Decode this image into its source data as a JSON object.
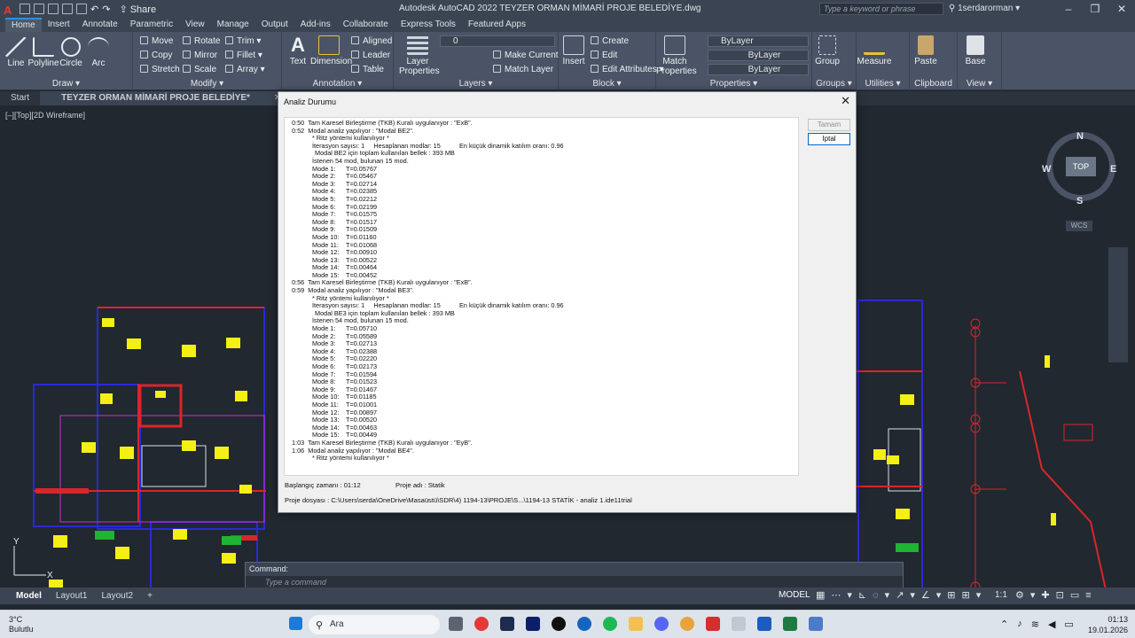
{
  "app": {
    "window_title": "Autodesk AutoCAD 2022   TEYZER ORMAN MİMARİ PROJE BELEDİYE.dwg",
    "share_label": "Share",
    "search_placeholder": "Type a keyword or phrase",
    "user_name": "1serdarorman"
  },
  "ribbon_tabs": [
    "Home",
    "Insert",
    "Annotate",
    "Parametric",
    "View",
    "Manage",
    "Output",
    "Add-ins",
    "Collaborate",
    "Express Tools",
    "Featured Apps"
  ],
  "ribbon": {
    "draw": {
      "label": "Draw",
      "line": "Line",
      "polyline": "Polyline",
      "circle": "Circle",
      "arc": "Arc"
    },
    "modify": {
      "label": "Modify",
      "move": "Move",
      "rotate": "Rotate",
      "trim": "Trim",
      "copy": "Copy",
      "mirror": "Mirror",
      "fillet": "Fillet",
      "stretch": "Stretch",
      "scale": "Scale",
      "array": "Array"
    },
    "annotation": {
      "label": "Annotation",
      "text": "Text",
      "dimension": "Dimension",
      "aligned": "Aligned",
      "leader": "Leader",
      "table": "Table"
    },
    "layers": {
      "label": "Layers",
      "layer_properties": "Layer Properties",
      "make_current": "Make Current",
      "match_layer": "Match Layer",
      "current_layer": "0"
    },
    "block": {
      "label": "Block",
      "insert": "Insert",
      "create": "Create",
      "edit": "Edit",
      "edit_attributes": "Edit Attributes"
    },
    "properties": {
      "label": "Properties",
      "match_properties": "Match Properties",
      "bylayer1": "ByLayer",
      "bylayer2": "ByLayer",
      "bylayer3": "ByLayer"
    },
    "groups": {
      "label": "Groups",
      "group": "Group"
    },
    "utilities": {
      "label": "Utilities",
      "measure": "Measure"
    },
    "clipboard": {
      "label": "Clipboard",
      "paste": "Paste"
    },
    "view": {
      "label": "View",
      "base": "Base"
    }
  },
  "doc_tabs": {
    "start": "Start",
    "active": "TEYZER ORMAN MİMARİ PROJE BELEDİYE*"
  },
  "viewport": {
    "label": "[–][Top][2D Wireframe]",
    "viewcube_top": "TOP",
    "compass_n": "N",
    "compass_s": "S",
    "compass_e": "E",
    "compass_w": "W",
    "wcs": "WCS"
  },
  "command": {
    "prompt": "Command:",
    "placeholder": "Type a command"
  },
  "layout_tabs": {
    "model": "Model",
    "layout1": "Layout1",
    "layout2": "Layout2"
  },
  "statusbar": {
    "model_label": "MODEL",
    "scale": "1:1"
  },
  "taskbar": {
    "temperature": "3°C",
    "weather": "Bulutlu",
    "search": "Ara",
    "time": "01:13",
    "date": "19.01.2026"
  },
  "dialog": {
    "title": "Analiz Durumu",
    "ok_button": "Tamam",
    "cancel_button": "Iptal",
    "start_time_label": "Başlangıç zamanı  :  01:12",
    "project_name_label": "Proje adı  :  Statik",
    "project_file_label": "Proje dosyası  :  C:\\Users\\serda\\OneDrive\\Masaüstü\\SDR\\4) 1194-13\\PROJE\\S...\\1194-13 STATİK - analiz 1.ide11trial",
    "log": {
      "l01": "0:50  Tam Karesel Birleştirme (TKB) Kuralı uygulanıyor : \"ExB\".",
      "l02": "0:52  Modal analiz yapılıyor : \"Modal BE2\".",
      "l03": "* Ritz yöntemi kullanılıyor *",
      "l04a": "İterasyon sayısı: 1     Hesaplanan modlar: 15",
      "l04b": "En küçük dinamik katılım oranı: 0.96",
      "l05": "Modal BE2 için toplam kullanılan bellek : 393 MB",
      "l06": "İstenen 54 mod, bulunan 15 mod.",
      "modes_be2": [
        [
          "Mode 1:",
          "T=0.05767"
        ],
        [
          "Mode 2:",
          "T=0.05467"
        ],
        [
          "Mode 3:",
          "T=0.02714"
        ],
        [
          "Mode 4:",
          "T=0.02385"
        ],
        [
          "Mode 5:",
          "T=0.02212"
        ],
        [
          "Mode 6:",
          "T=0.02199"
        ],
        [
          "Mode 7:",
          "T=0.01575"
        ],
        [
          "Mode 8:",
          "T=0.01517"
        ],
        [
          "Mode 9:",
          "T=0.01509"
        ],
        [
          "Mode 10:",
          "T=0.01160"
        ],
        [
          "Mode 11:",
          "T=0.01068"
        ],
        [
          "Mode 12:",
          "T=0.00910"
        ],
        [
          "Mode 13:",
          "T=0.00522"
        ],
        [
          "Mode 14:",
          "T=0.00464"
        ],
        [
          "Mode 15:",
          "T=0.00452"
        ]
      ],
      "l07": "0:56  Tam Karesel Birleştirme (TKB) Kuralı uygulanıyor : \"ExB\".",
      "l08": "0:59  Modal analiz yapılıyor : \"Modal BE3\".",
      "l09": "* Ritz yöntemi kullanılıyor *",
      "l10a": "İterasyon sayısı: 1     Hesaplanan modlar: 15",
      "l10b": "En küçük dinamik katılım oranı: 0.96",
      "l11": "Modal BE3 için toplam kullanılan bellek : 393 MB",
      "l12": "İstenen 54 mod, bulunan 15 mod.",
      "modes_be3": [
        [
          "Mode 1:",
          "T=0.05710"
        ],
        [
          "Mode 2:",
          "T=0.05589"
        ],
        [
          "Mode 3:",
          "T=0.02713"
        ],
        [
          "Mode 4:",
          "T=0.02388"
        ],
        [
          "Mode 5:",
          "T=0.02220"
        ],
        [
          "Mode 6:",
          "T=0.02173"
        ],
        [
          "Mode 7:",
          "T=0.01594"
        ],
        [
          "Mode 8:",
          "T=0.01523"
        ],
        [
          "Mode 9:",
          "T=0.01467"
        ],
        [
          "Mode 10:",
          "T=0.01185"
        ],
        [
          "Mode 11:",
          "T=0.01001"
        ],
        [
          "Mode 12:",
          "T=0.00897"
        ],
        [
          "Mode 13:",
          "T=0.00520"
        ],
        [
          "Mode 14:",
          "T=0.00463"
        ],
        [
          "Mode 15:",
          "T=0.00449"
        ]
      ],
      "l13": "1:03  Tam Karesel Birleştirme (TKB) Kuralı uygulanıyor : \"EyB\".",
      "l14": "1:06  Modal analiz yapılıyor : \"Modal BE4\".",
      "l15": "* Ritz yöntemi kullanılıyor *"
    }
  },
  "colors": {
    "accent": "#2d8fe6",
    "plan_blue": "#2a2ad6",
    "plan_red": "#d8262a",
    "plan_yellow": "#f4ef14",
    "plan_magenta": "#d22ad0",
    "plan_green": "#1fb431"
  }
}
